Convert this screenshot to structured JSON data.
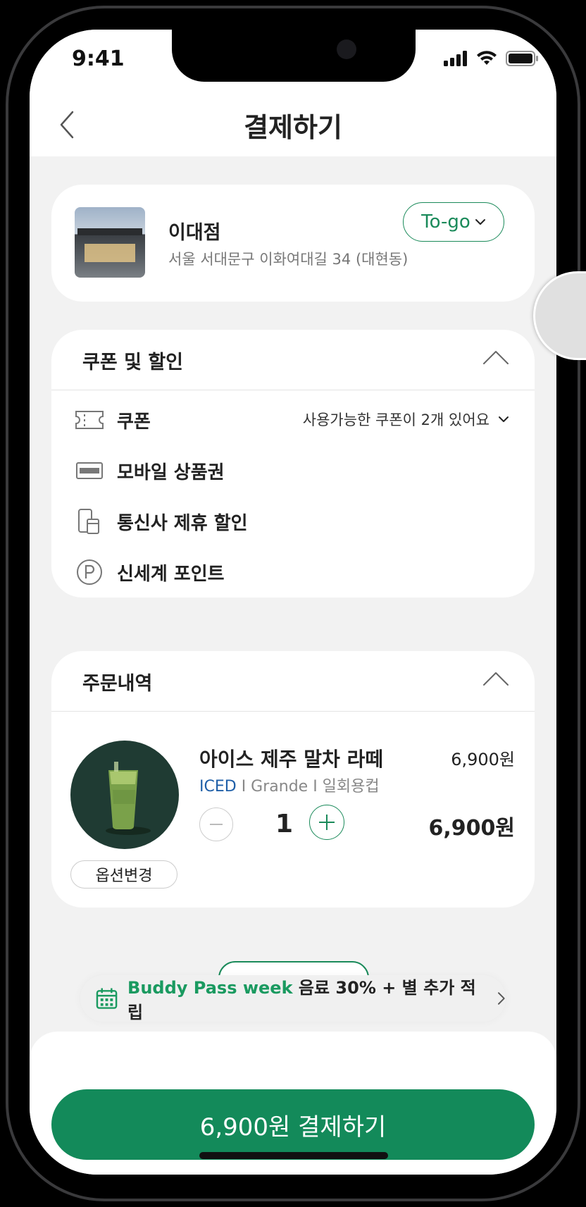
{
  "status_bar": {
    "time": "9:41"
  },
  "header": {
    "title": "결제하기"
  },
  "store": {
    "name": "이대점",
    "address": "서울 서대문구 이화여대길 34 (대현동)",
    "order_type": "To-go"
  },
  "discounts": {
    "title": "쿠폰 및 할인",
    "items": [
      {
        "label": "쿠폰",
        "icon": "ticket-icon"
      },
      {
        "label": "모바일 상품권",
        "icon": "gift-card-icon"
      },
      {
        "label": "통신사 제휴 할인",
        "icon": "phone-cup-icon"
      },
      {
        "label": "신세계 포인트",
        "icon": "point-p-icon"
      }
    ],
    "coupon_available": "사용가능한 쿠폰이 2개 있어요"
  },
  "order": {
    "title": "주문내역",
    "item": {
      "name": "아이스 제주 말차 라떼",
      "unit_price": "6,900원",
      "option_temp": "ICED",
      "option_rest": " I Grande I 일회용컵",
      "quantity": "1",
      "line_total": "6,900원",
      "option_change_label": "옵션변경"
    }
  },
  "promo": {
    "highlight": "Buddy Pass week",
    "text": " 음료 30% + 별 추가 적립"
  },
  "pay": {
    "button_label": "6,900원 결제하기"
  },
  "colors": {
    "brand_green": "#138a5a",
    "accent_green": "#1a9a60",
    "iced_blue": "#1f5fa8"
  }
}
